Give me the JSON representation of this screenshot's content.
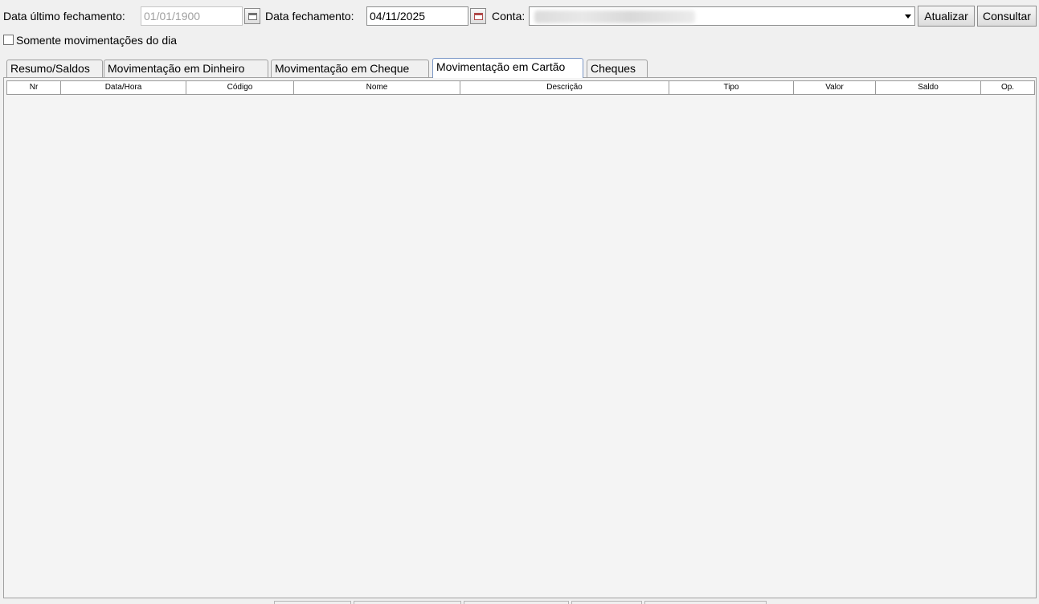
{
  "toolbar": {
    "ultimo_label": "Data último fechamento:",
    "ultimo_value": "01/01/1900",
    "fechamento_label": "Data fechamento:",
    "fechamento_value": "04/11/2025",
    "conta_label": "Conta:",
    "atualizar_label": "Atualizar",
    "consultar_label": "Consultar"
  },
  "filters": {
    "somente_label": "Somente movimentações do dia",
    "somente_checked": false
  },
  "tabs": [
    {
      "label": "Resumo/Saldos",
      "active": false
    },
    {
      "label": "Movimentação em Dinheiro",
      "active": false
    },
    {
      "label": "Movimentação em Cheque",
      "active": false
    },
    {
      "label": "Movimentação em Cartão",
      "active": true
    },
    {
      "label": "Cheques",
      "active": false
    }
  ],
  "grid": {
    "columns": [
      "Nr",
      "Data/Hora",
      "Código",
      "Nome",
      "Descrição",
      "Tipo",
      "Valor",
      "Saldo",
      "Op."
    ],
    "rows": []
  }
}
